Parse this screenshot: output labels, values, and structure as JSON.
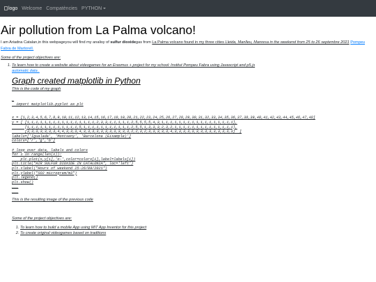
{
  "nav": {
    "logo_alt": "logo",
    "items": [
      "Welcome",
      "Compatències",
      "PYTHON"
    ]
  },
  "page": {
    "title": "Air pollution from La Palma volcano!",
    "intro_1": "I am Ariadna Catalan,in this webpageyou will find my analisy of ",
    "intro_bold": "sulfur dioxide",
    "intro_2": "gas from ",
    "intro_link_1": "La Palma volcano found in my three cities ",
    "intro_link_cities": "Lleida, Manlleu, Manresa in the weekend from 25 to 26 septembre 2021",
    "intro_link_2": "Pompeu Fabra de Martorell.",
    "objectives_title": "Some of the project objectives are:",
    "objective_1": "To learn how to create a website about videogames for an Erasmus + project for my school: Institut Pompeu Fabra using Javascript and p5.js",
    "objective_1_cont": "automatic data .",
    "section_title": "Graph created matplotlib in Python",
    "code_intro": "This is the code of my graph",
    "code_lines": [
      "_",
      "  import matplotlib.pyplot as plt",
      "",
      "",
      "x = [1,2,3,4,5,6,7,8,9,10,11,12,13,14,15,16,17,18,19,20,21,22,23,24,25,26,27,28,29,30,31,32,33,34,35,36,37,38,39,40,41,42,43,44,45,46,47,48]",
      "y = [ [1,1,1,1,1,1,1,1,1,1,1,1,1,1,1,1,2,3,3,1,1,1,1,1,2,5,5,5,5,4,3,1,1,1,1,1,1,1,1,1,1,1,1,1,1,1,1,1],",
      "      [1,1,1,1,1,1,1,1,1,1,1,1,5,1,1,1,1,1,1,1,1,1,1,1,2,5,5,1,3,3,3,2,3,2,1,1,1,1,1,1,1,1,1,1,1,1,1,1],",
      "      [3,3,3,3,3,3,3,4,4,3,3,3,4,3,3,3,3,3,3,3,3,3,3,3,2,2,3,2,3,3,3,3,3,4,3,3,3,3,3,3,3,3,3,3,3,3,3,3]  ]",
      "labels=['Igualada', 'Montseny', 'Barcelona (Eixample)']",
      "colors=['r','g','b']",
      "",
      "# loop over data, labels and colors",
      "for i in range(len(x)):",
      "    plt.plot(x,y[i],'o-',color=colors[i],label=labels[i])",
      "plt.title(\"AIR SULFUR DIOXIDE IN CATALONIA\", loc='left')",
      "plt.xlabel(\"Hours of weekend 25-26/09/2021\")",
      "plt.ylabel(\"SO2 microgram/m3\")",
      "plt.legend()",
      "plt.show()",
      "___",
      "___"
    ],
    "result_caption": "This is the resulting image of the previous code",
    "objectives_title_2": "Some of the project objectives are:",
    "objectives_2": [
      "To learn how to build a mobile App using MIT App Inventor for this project",
      "To create original videogames based on traditions"
    ]
  }
}
